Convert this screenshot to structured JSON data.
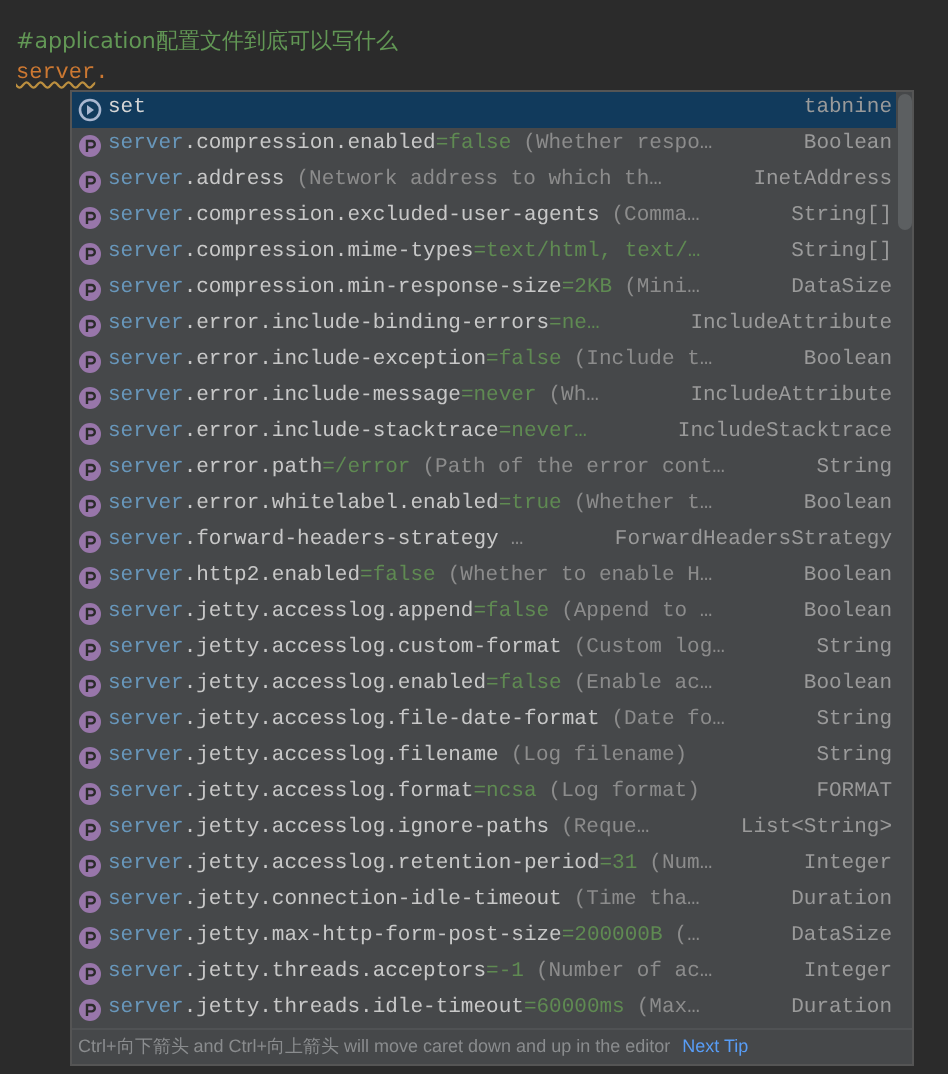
{
  "editor": {
    "comment": "#application配置文件到底可以写什么",
    "typed_prefix": "server",
    "typed_rest": "."
  },
  "completion": {
    "items": [
      {
        "kind": "suggestion",
        "selected": true,
        "name": "set",
        "type": "tabnine"
      },
      {
        "kind": "property",
        "selected": false,
        "prefix": "server",
        "name": ".compression.enabled",
        "default": "=false",
        "desc": "(Whether respo…",
        "type": "Boolean"
      },
      {
        "kind": "property",
        "selected": false,
        "prefix": "server",
        "name": ".address",
        "desc": "(Network address to which th…",
        "type": "InetAddress"
      },
      {
        "kind": "property",
        "selected": false,
        "prefix": "server",
        "name": ".compression.excluded-user-agents",
        "desc": "(Comma…",
        "type": "String[]"
      },
      {
        "kind": "property",
        "selected": false,
        "prefix": "server",
        "name": ".compression.mime-types",
        "default": "=text/html, text/…",
        "type": "String[]"
      },
      {
        "kind": "property",
        "selected": false,
        "prefix": "server",
        "name": ".compression.min-response-size",
        "default": "=2KB",
        "desc": "(Mini…",
        "type": "DataSize"
      },
      {
        "kind": "property",
        "selected": false,
        "prefix": "server",
        "name": ".error.include-binding-errors",
        "default": "=ne…",
        "type": "IncludeAttribute"
      },
      {
        "kind": "property",
        "selected": false,
        "prefix": "server",
        "name": ".error.include-exception",
        "default": "=false",
        "desc": "(Include t…",
        "type": "Boolean"
      },
      {
        "kind": "property",
        "selected": false,
        "prefix": "server",
        "name": ".error.include-message",
        "default": "=never",
        "desc": "(Wh…",
        "type": "IncludeAttribute"
      },
      {
        "kind": "property",
        "selected": false,
        "prefix": "server",
        "name": ".error.include-stacktrace",
        "default": "=never…",
        "type": "IncludeStacktrace"
      },
      {
        "kind": "property",
        "selected": false,
        "prefix": "server",
        "name": ".error.path",
        "default": "=/error",
        "desc": "(Path of the error cont…",
        "type": "String"
      },
      {
        "kind": "property",
        "selected": false,
        "prefix": "server",
        "name": ".error.whitelabel.enabled",
        "default": "=true",
        "desc": "(Whether t…",
        "type": "Boolean"
      },
      {
        "kind": "property",
        "selected": false,
        "prefix": "server",
        "name": ".forward-headers-strategy",
        "desc": "…",
        "type": "ForwardHeadersStrategy"
      },
      {
        "kind": "property",
        "selected": false,
        "prefix": "server",
        "name": ".http2.enabled",
        "default": "=false",
        "desc": "(Whether to enable H…",
        "type": "Boolean"
      },
      {
        "kind": "property",
        "selected": false,
        "prefix": "server",
        "name": ".jetty.accesslog.append",
        "default": "=false",
        "desc": "(Append to …",
        "type": "Boolean"
      },
      {
        "kind": "property",
        "selected": false,
        "prefix": "server",
        "name": ".jetty.accesslog.custom-format",
        "desc": "(Custom log…",
        "type": "String"
      },
      {
        "kind": "property",
        "selected": false,
        "prefix": "server",
        "name": ".jetty.accesslog.enabled",
        "default": "=false",
        "desc": "(Enable ac…",
        "type": "Boolean"
      },
      {
        "kind": "property",
        "selected": false,
        "prefix": "server",
        "name": ".jetty.accesslog.file-date-format",
        "desc": "(Date fo…",
        "type": "String"
      },
      {
        "kind": "property",
        "selected": false,
        "prefix": "server",
        "name": ".jetty.accesslog.filename",
        "desc": "(Log filename)",
        "type": "String"
      },
      {
        "kind": "property",
        "selected": false,
        "prefix": "server",
        "name": ".jetty.accesslog.format",
        "default": "=ncsa",
        "desc": "(Log format)",
        "type": "FORMAT"
      },
      {
        "kind": "property",
        "selected": false,
        "prefix": "server",
        "name": ".jetty.accesslog.ignore-paths",
        "desc": "(Reque…",
        "type": "List<String>"
      },
      {
        "kind": "property",
        "selected": false,
        "prefix": "server",
        "name": ".jetty.accesslog.retention-period",
        "default": "=31",
        "desc": "(Num…",
        "type": "Integer"
      },
      {
        "kind": "property",
        "selected": false,
        "prefix": "server",
        "name": ".jetty.connection-idle-timeout",
        "desc": "(Time tha…",
        "type": "Duration"
      },
      {
        "kind": "property",
        "selected": false,
        "prefix": "server",
        "name": ".jetty.max-http-form-post-size",
        "default": "=200000B",
        "desc": "(…",
        "type": "DataSize"
      },
      {
        "kind": "property",
        "selected": false,
        "prefix": "server",
        "name": ".jetty.threads.acceptors",
        "default": "=-1",
        "desc": "(Number of ac…",
        "type": "Integer"
      },
      {
        "kind": "property",
        "selected": false,
        "prefix": "server",
        "name": ".jetty.threads.idle-timeout",
        "default": "=60000ms",
        "desc": "(Max…",
        "type": "Duration"
      }
    ],
    "footer": {
      "hint": "Ctrl+向下箭头 and Ctrl+向上箭头 will move caret down and up in the editor",
      "link": "Next Tip"
    }
  }
}
